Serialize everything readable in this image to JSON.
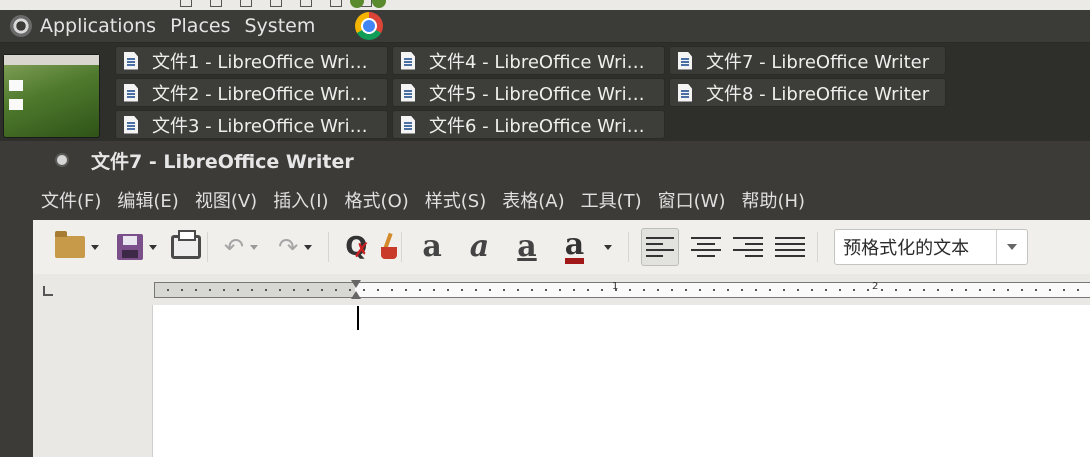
{
  "panel": {
    "menus": [
      "Applications",
      "Places",
      "System"
    ]
  },
  "taskbar": {
    "windows": [
      {
        "label": "文件1 - LibreOffice Wri…"
      },
      {
        "label": "文件2 - LibreOffice Wri…"
      },
      {
        "label": "文件3 - LibreOffice Wri…"
      },
      {
        "label": "文件4 - LibreOffice Wri…"
      },
      {
        "label": "文件5 - LibreOffice Wri…"
      },
      {
        "label": "文件6 - LibreOffice Wri…"
      },
      {
        "label": "文件7 - LibreOffice Writer"
      },
      {
        "label": "文件8 - LibreOffice Writer"
      }
    ]
  },
  "window": {
    "title": "文件7 - LibreOffice Writer"
  },
  "menubar": {
    "items": [
      "文件(F)",
      "编辑(E)",
      "视图(V)",
      "插入(I)",
      "格式(O)",
      "样式(S)",
      "表格(A)",
      "工具(T)",
      "窗口(W)",
      "帮助(H)"
    ]
  },
  "toolbar": {
    "font_sample": "a",
    "paragraph_style": "预格式化的文本",
    "colors": {
      "font_color": "#a01818"
    }
  },
  "ruler": {
    "labels": [
      "1",
      "2"
    ]
  }
}
